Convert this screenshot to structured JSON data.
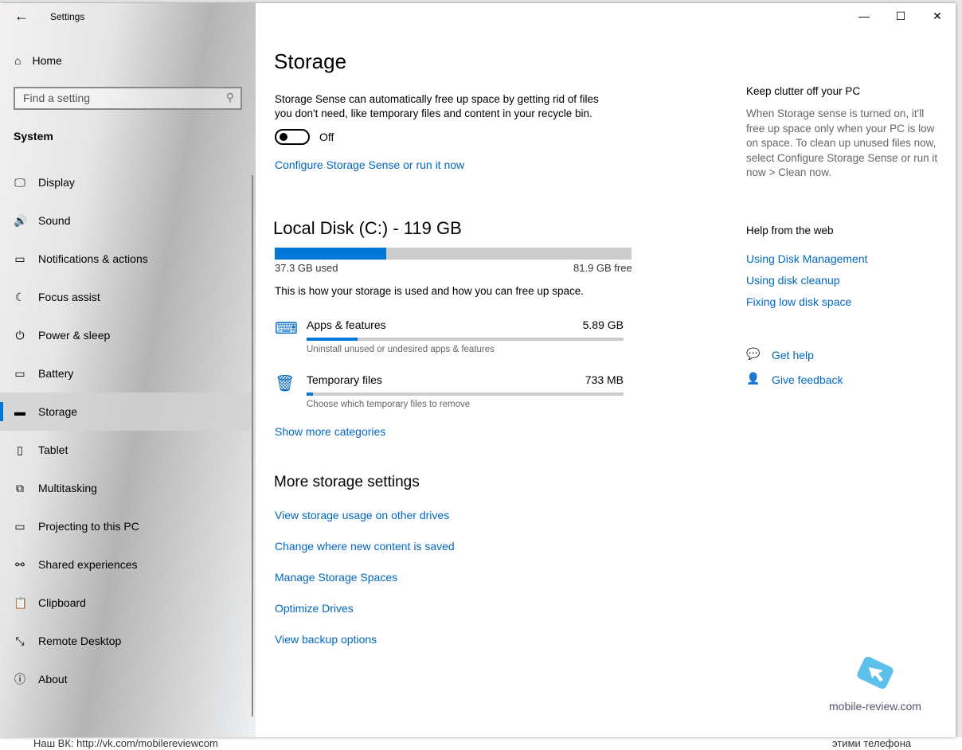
{
  "background": {
    "left_text": "Наш ВК: http://vk.com/mobilereviewcom",
    "right_text": "этими телефона"
  },
  "app_title": "Settings",
  "sidebar": {
    "home": "Home",
    "search_placeholder": "Find a setting",
    "section": "System",
    "items": [
      {
        "label": "Display",
        "icon": "monitor-icon"
      },
      {
        "label": "Sound",
        "icon": "speaker-icon"
      },
      {
        "label": "Notifications & actions",
        "icon": "notification-icon"
      },
      {
        "label": "Focus assist",
        "icon": "moon-icon"
      },
      {
        "label": "Power & sleep",
        "icon": "power-icon"
      },
      {
        "label": "Battery",
        "icon": "battery-icon"
      },
      {
        "label": "Storage",
        "icon": "storage-icon",
        "selected": true
      },
      {
        "label": "Tablet",
        "icon": "tablet-icon"
      },
      {
        "label": "Multitasking",
        "icon": "multitasking-icon"
      },
      {
        "label": "Projecting to this PC",
        "icon": "projector-icon"
      },
      {
        "label": "Shared experiences",
        "icon": "share-icon"
      },
      {
        "label": "Clipboard",
        "icon": "clipboard-icon"
      },
      {
        "label": "Remote Desktop",
        "icon": "remote-icon"
      },
      {
        "label": "About",
        "icon": "info-icon"
      }
    ]
  },
  "main": {
    "title": "Storage",
    "sense_desc": "Storage Sense can automatically free up space by getting rid of files you don't need, like temporary files and content in your recycle bin.",
    "toggle_state": "Off",
    "configure_link": "Configure Storage Sense or run it now",
    "disk": {
      "title": "Local Disk (C:) - 119 GB",
      "used": "37.3 GB used",
      "free": "81.9 GB free",
      "used_percent": 31.3
    },
    "usage_desc": "This is how your storage is used and how you can free up space.",
    "categories": [
      {
        "name": "Apps & features",
        "size": "5.89 GB",
        "desc": "Uninstall unused or undesired apps & features",
        "percent": 16,
        "icon": "keyboard-icon"
      },
      {
        "name": "Temporary files",
        "size": "733 MB",
        "desc": "Choose which temporary files to remove",
        "percent": 2,
        "icon": "trash-icon"
      }
    ],
    "show_more": "Show more categories",
    "more_title": "More storage settings",
    "more_links": [
      "View storage usage on other drives",
      "Change where new content is saved",
      "Manage Storage Spaces",
      "Optimize Drives",
      "View backup options"
    ]
  },
  "right": {
    "clutter_title": "Keep clutter off your PC",
    "clutter_text": "When Storage sense is turned on, it'll free up space only when your PC is low on space. To clean up unused files now, select Configure Storage Sense or run it now > Clean now.",
    "help_title": "Help from the web",
    "help_links": [
      "Using Disk Management",
      "Using disk cleanup",
      "Fixing low disk space"
    ],
    "get_help": "Get help",
    "feedback": "Give feedback"
  },
  "watermark": "mobile-review.com",
  "accent": "#0078d7"
}
